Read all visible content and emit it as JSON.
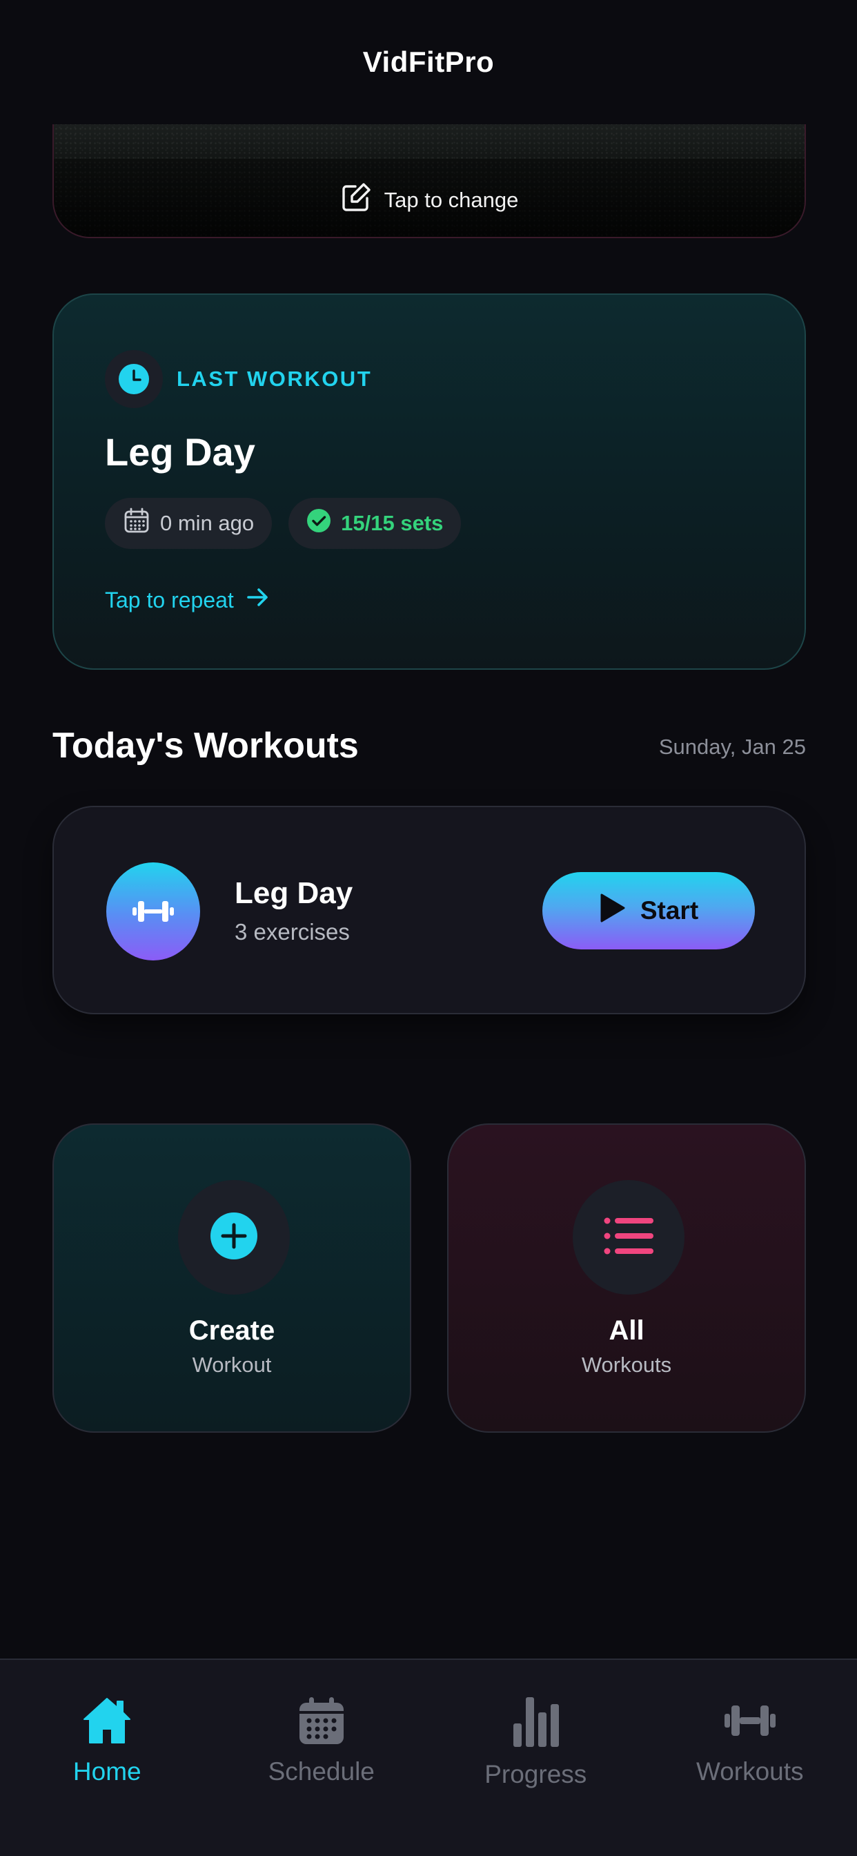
{
  "app": {
    "title": "VidFitPro"
  },
  "hero": {
    "change_label": "Tap to change"
  },
  "last_workout": {
    "label": "LAST WORKOUT",
    "title": "Leg Day",
    "time_ago": "0 min ago",
    "sets": "15/15 sets",
    "repeat_label": "Tap to repeat"
  },
  "today": {
    "section_title": "Today's Workouts",
    "date": "Sunday, Jan 25",
    "workout": {
      "name": "Leg Day",
      "exercises": "3 exercises",
      "start_label": "Start"
    }
  },
  "tiles": {
    "create": {
      "title": "Create",
      "subtitle": "Workout"
    },
    "all": {
      "title": "All",
      "subtitle": "Workouts"
    }
  },
  "nav": {
    "items": [
      {
        "label": "Home",
        "icon": "home-icon",
        "active": true
      },
      {
        "label": "Schedule",
        "icon": "calendar-icon",
        "active": false
      },
      {
        "label": "Progress",
        "icon": "bar-chart-icon",
        "active": false
      },
      {
        "label": "Workouts",
        "icon": "dumbbell-icon",
        "active": false
      }
    ]
  },
  "colors": {
    "accent": "#22d3ee",
    "purple": "#8b5cf6",
    "pink": "#f0457f",
    "success": "#34d37c",
    "background": "#0b0b10"
  }
}
